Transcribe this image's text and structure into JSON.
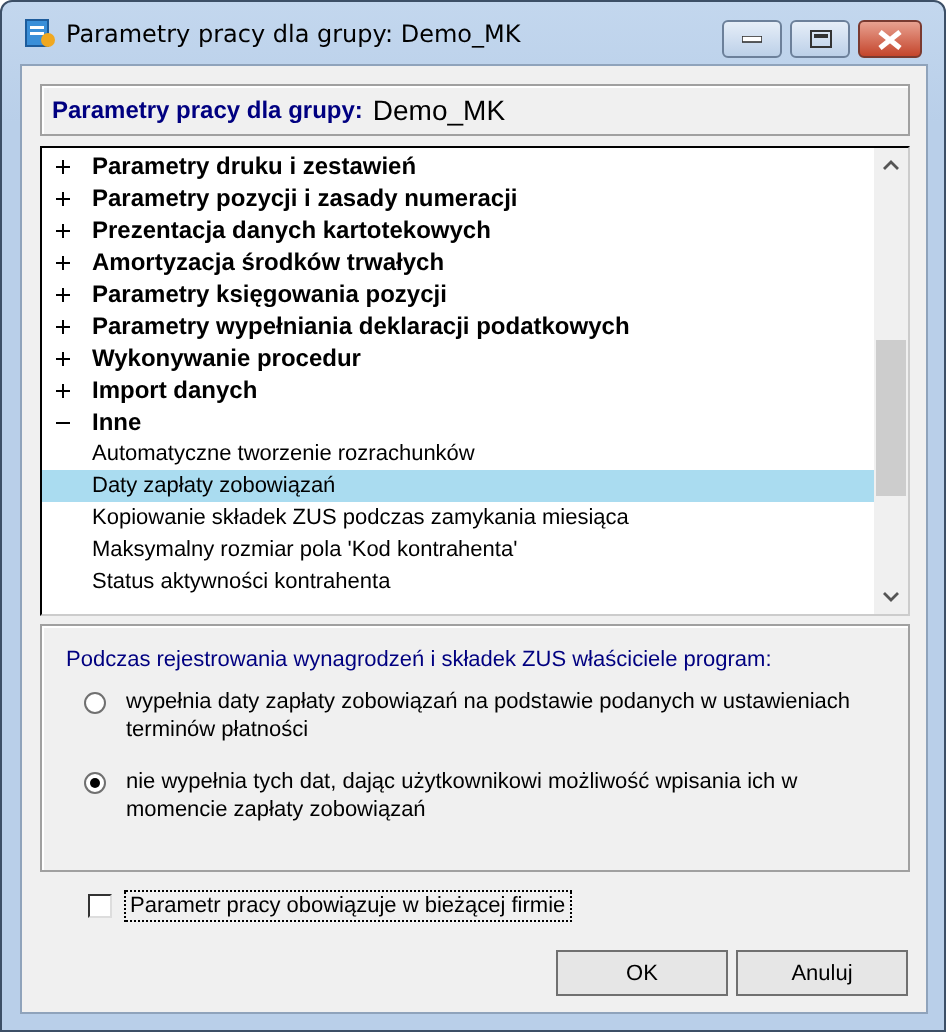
{
  "window": {
    "title": "Parametry pracy dla grupy: Demo_MK"
  },
  "header": {
    "label": "Parametry pracy dla grupy:",
    "group": "Demo_MK"
  },
  "tree": [
    {
      "label": "Parametry druku i zestawień",
      "expanded": false,
      "selected": false
    },
    {
      "label": "Parametry pozycji i zasady numeracji",
      "expanded": false,
      "selected": false
    },
    {
      "label": "Prezentacja danych kartotekowych",
      "expanded": false,
      "selected": false
    },
    {
      "label": "Amortyzacja środków trwałych",
      "expanded": false,
      "selected": false
    },
    {
      "label": "Parametry księgowania pozycji",
      "expanded": false,
      "selected": false
    },
    {
      "label": "Parametry wypełniania deklaracji podatkowych",
      "expanded": false,
      "selected": false
    },
    {
      "label": "Wykonywanie procedur",
      "expanded": false,
      "selected": false
    },
    {
      "label": "Import danych",
      "expanded": false,
      "selected": false
    },
    {
      "label": "Inne",
      "expanded": true,
      "selected": false,
      "children": [
        {
          "label": "Automatyczne tworzenie rozrachunków",
          "selected": false
        },
        {
          "label": "Daty zapłaty zobowiązań",
          "selected": true
        },
        {
          "label": "Kopiowanie składek ZUS podczas zamykania miesiąca",
          "selected": false
        },
        {
          "label": "Maksymalny rozmiar pola 'Kod kontrahenta'",
          "selected": false
        },
        {
          "label": "Status aktywności kontrahenta",
          "selected": false
        }
      ]
    }
  ],
  "options": {
    "prompt": "Podczas rejestrowania wynagrodzeń i składek ZUS właściciele program:",
    "choices": [
      {
        "label": "wypełnia daty zapłaty zobowiązań na podstawie podanych w ustawieniach terminów płatności",
        "selected": false
      },
      {
        "label": "nie wypełnia tych dat, dając użytkownikowi możliwość wpisania ich w momencie zapłaty zobowiązań",
        "selected": true
      }
    ]
  },
  "applies_checkbox": {
    "label": "Parametr pracy obowiązuje w bieżącej firmie",
    "checked": false
  },
  "buttons": [
    "OK",
    "Anuluj"
  ]
}
